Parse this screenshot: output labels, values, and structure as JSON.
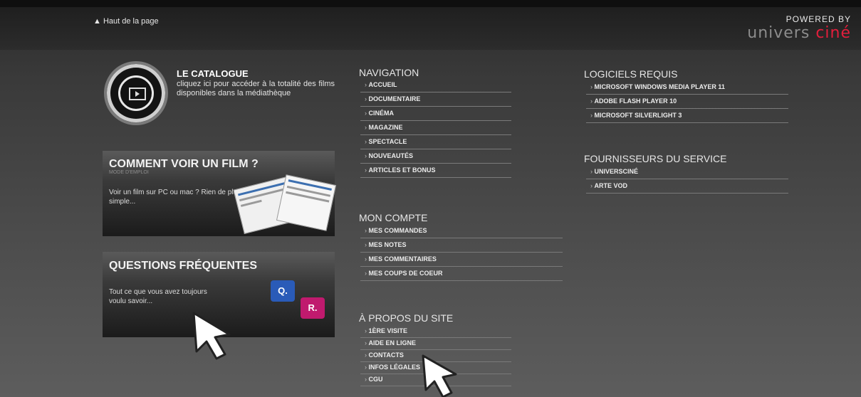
{
  "header": {
    "back_to_top": "▲ Haut de la page",
    "powered_by": "POWERED BY",
    "logo_main": "univers",
    "logo_accent": "ciné"
  },
  "catalogue": {
    "title": "LE CATALOGUE",
    "description": "cliquez ici pour accéder à la totalité des films disponibles dans la médiathèque"
  },
  "card_film": {
    "title": "COMMENT VOIR UN FILM ?",
    "subtitle": "MODE D'EMPLOI",
    "text": "Voir un film sur PC ou mac ? Rien de plus simple..."
  },
  "card_faq": {
    "title": "QUESTIONS FRÉQUENTES",
    "text": "Tout ce que vous avez toujours voulu savoir...",
    "bubble_q": "Q.",
    "bubble_r": "R."
  },
  "navigation": {
    "heading": "NAVIGATION",
    "items": [
      "ACCUEIL",
      "DOCUMENTAIRE",
      "CINÉMA",
      "MAGAZINE",
      "SPECTACLE",
      "NOUVEAUTÉS",
      "ARTICLES ET BONUS"
    ]
  },
  "account": {
    "heading": "MON COMPTE",
    "items": [
      "MES COMMANDES",
      "MES NOTES",
      "MES COMMENTAIRES",
      "MES COUPS DE COEUR"
    ]
  },
  "about": {
    "heading": "À PROPOS DU SITE",
    "items": [
      "1ÈRE VISITE",
      "AIDE EN LIGNE",
      "CONTACTS",
      "INFOS LÉGALES",
      "CGU"
    ]
  },
  "software": {
    "heading": "LOGICIELS REQUIS",
    "items": [
      "MICROSOFT WINDOWS MEDIA PLAYER 11",
      "ADOBE FLASH PLAYER 10",
      "MICROSOFT SILVERLIGHT 3"
    ]
  },
  "providers": {
    "heading": "FOURNISSEURS DU SERVICE",
    "items": [
      "UNIVERSCINÉ",
      "ARTE VOD"
    ]
  },
  "colors": {
    "accent": "#e31e3c",
    "bubble_q": "#2a5bb8",
    "bubble_r": "#c01a6e"
  }
}
